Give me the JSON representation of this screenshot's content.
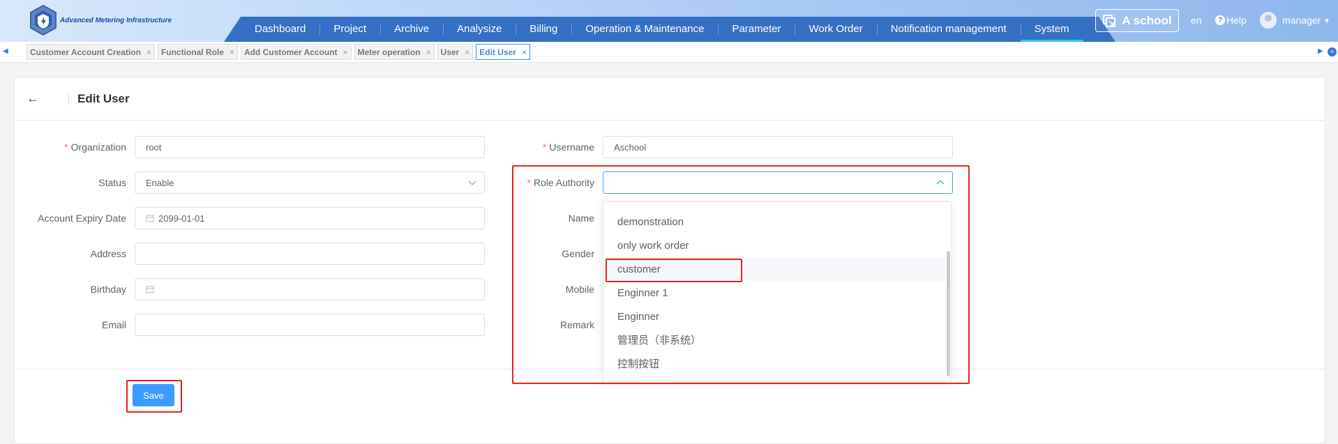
{
  "header": {
    "logo_text": "Advanced Metering Infrastructure",
    "nav": [
      "Dashboard",
      "Project",
      "Archive",
      "Analysize",
      "Billing",
      "Operation & Maintenance",
      "Parameter",
      "Work Order",
      "Notification management",
      "System"
    ],
    "active_nav": "System",
    "school": "A school",
    "lang": "en",
    "help": "Help",
    "user": "manager"
  },
  "tabs": [
    {
      "label": "Customer Account Creation"
    },
    {
      "label": "Functional Role"
    },
    {
      "label": "Add Customer Account"
    },
    {
      "label": "Meter operation"
    },
    {
      "label": "User"
    },
    {
      "label": "Edit User",
      "active": true
    }
  ],
  "page": {
    "title": "Edit User",
    "save_label": "Save"
  },
  "form": {
    "organization": {
      "label": "Organization",
      "value": "root"
    },
    "status": {
      "label": "Status",
      "value": "Enable"
    },
    "expiry": {
      "label": "Account Expiry Date",
      "value": "2099-01-01"
    },
    "address": {
      "label": "Address",
      "value": ""
    },
    "birthday": {
      "label": "Birthday",
      "value": ""
    },
    "email": {
      "label": "Email",
      "value": ""
    },
    "username": {
      "label": "Username",
      "value": "Aschool"
    },
    "role": {
      "label": "Role Authority",
      "value": ""
    },
    "name": {
      "label": "Name"
    },
    "gender": {
      "label": "Gender"
    },
    "mobile": {
      "label": "Mobile"
    },
    "remark": {
      "label": "Remark"
    }
  },
  "role_options": [
    "demonstration",
    "only work order",
    "customer",
    "Enginner 1",
    "Enginner",
    "管理员（非系统）",
    "控制按钮"
  ],
  "hovered_option": "customer",
  "colors": {
    "primary": "#3d9bff",
    "nav_bg": "#3470c3",
    "highlight": "#e8221c"
  }
}
